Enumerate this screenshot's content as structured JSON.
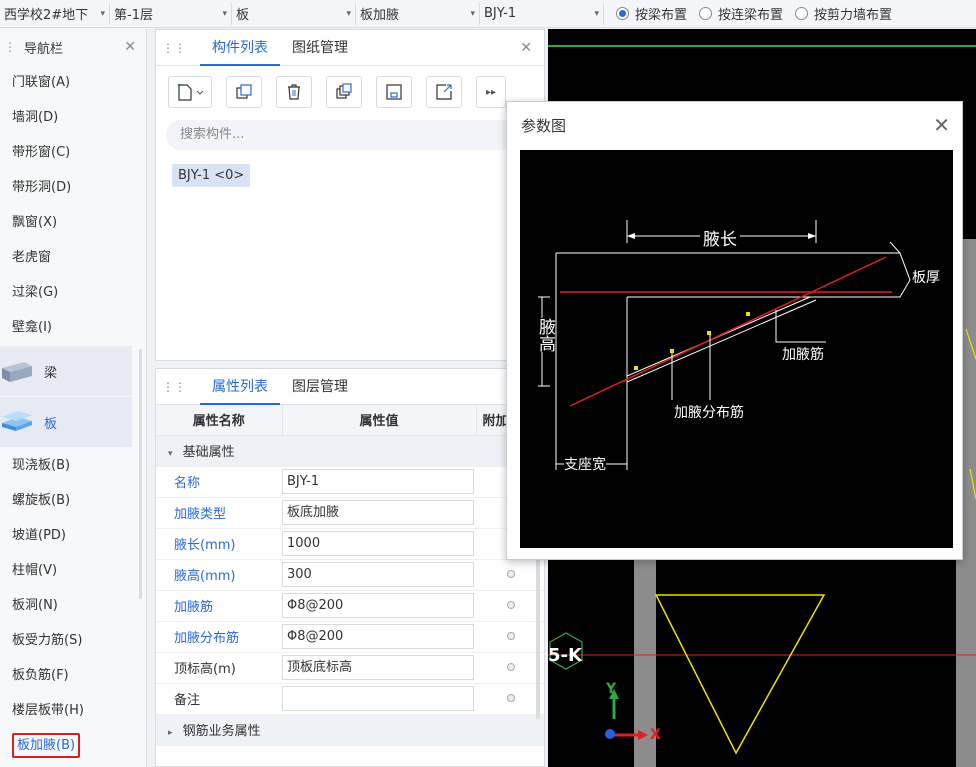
{
  "topbar": {
    "project": "西学校2#地下",
    "floor": "第-1层",
    "category": "板",
    "component_type": "板加腋",
    "component": "BJY-1",
    "radios": [
      {
        "label": "按梁布置",
        "checked": true
      },
      {
        "label": "按连梁布置",
        "checked": false
      },
      {
        "label": "按剪力墙布置",
        "checked": false
      }
    ]
  },
  "nav": {
    "title": "导航栏",
    "items_top": [
      "门联窗(A)",
      "墙洞(D)",
      "带形窗(C)",
      "带形洞(D)",
      "飘窗(X)",
      "老虎窗",
      "过梁(G)",
      "壁龛(I)"
    ],
    "cat_beam": "梁",
    "cat_slab": "板",
    "items_bottom": [
      "现浇板(B)",
      "螺旋板(B)",
      "坡道(PD)",
      "柱帽(V)",
      "板洞(N)",
      "板受力筋(S)",
      "板负筋(F)",
      "楼层板带(H)"
    ],
    "selected": "板加腋(B)"
  },
  "component_panel": {
    "tab1": "构件列表",
    "tab2": "图纸管理",
    "search_placeholder": "搜索构件...",
    "chip": "BJY-1 <0>"
  },
  "property_panel": {
    "tab1": "属性列表",
    "tab2": "图层管理",
    "col_name": "属性名称",
    "col_value": "属性值",
    "col_extra": "附加",
    "group_basic": "基础属性",
    "rows": [
      {
        "name": "名称",
        "value": "BJY-1",
        "blue": true,
        "check": false
      },
      {
        "name": "加腋类型",
        "value": "板底加腋",
        "blue": true,
        "check": true
      },
      {
        "name": "腋长(mm)",
        "value": "1000",
        "blue": true,
        "check": true
      },
      {
        "name": "腋高(mm)",
        "value": "300",
        "blue": true,
        "check": true
      },
      {
        "name": "加腋筋",
        "value": "Φ8@200",
        "blue": true,
        "check": true
      },
      {
        "name": "加腋分布筋",
        "value": "Φ8@200",
        "blue": true,
        "check": true
      },
      {
        "name": "顶标高(m)",
        "value": "顶板底标高",
        "blue": false,
        "check": true
      },
      {
        "name": "备注",
        "value": "",
        "blue": false,
        "check": true
      }
    ],
    "group_rebar": "钢筋业务属性"
  },
  "dialog": {
    "title": "参数图",
    "labels": {
      "haunch_length": "腋长",
      "slab_thickness": "板厚",
      "haunch_height": "腋高",
      "haunch_rebar": "加腋筋",
      "distribution_rebar": "加腋分布筋",
      "support_width": "支座宽"
    }
  },
  "canvas": {
    "axis_label": "5-K",
    "y_axis": "Y",
    "x_axis": "X"
  },
  "colors": {
    "accent": "#2a6ad8",
    "selection_border": "#d92020",
    "cad_red": "#e02020",
    "cad_yellow": "#f0e000"
  }
}
